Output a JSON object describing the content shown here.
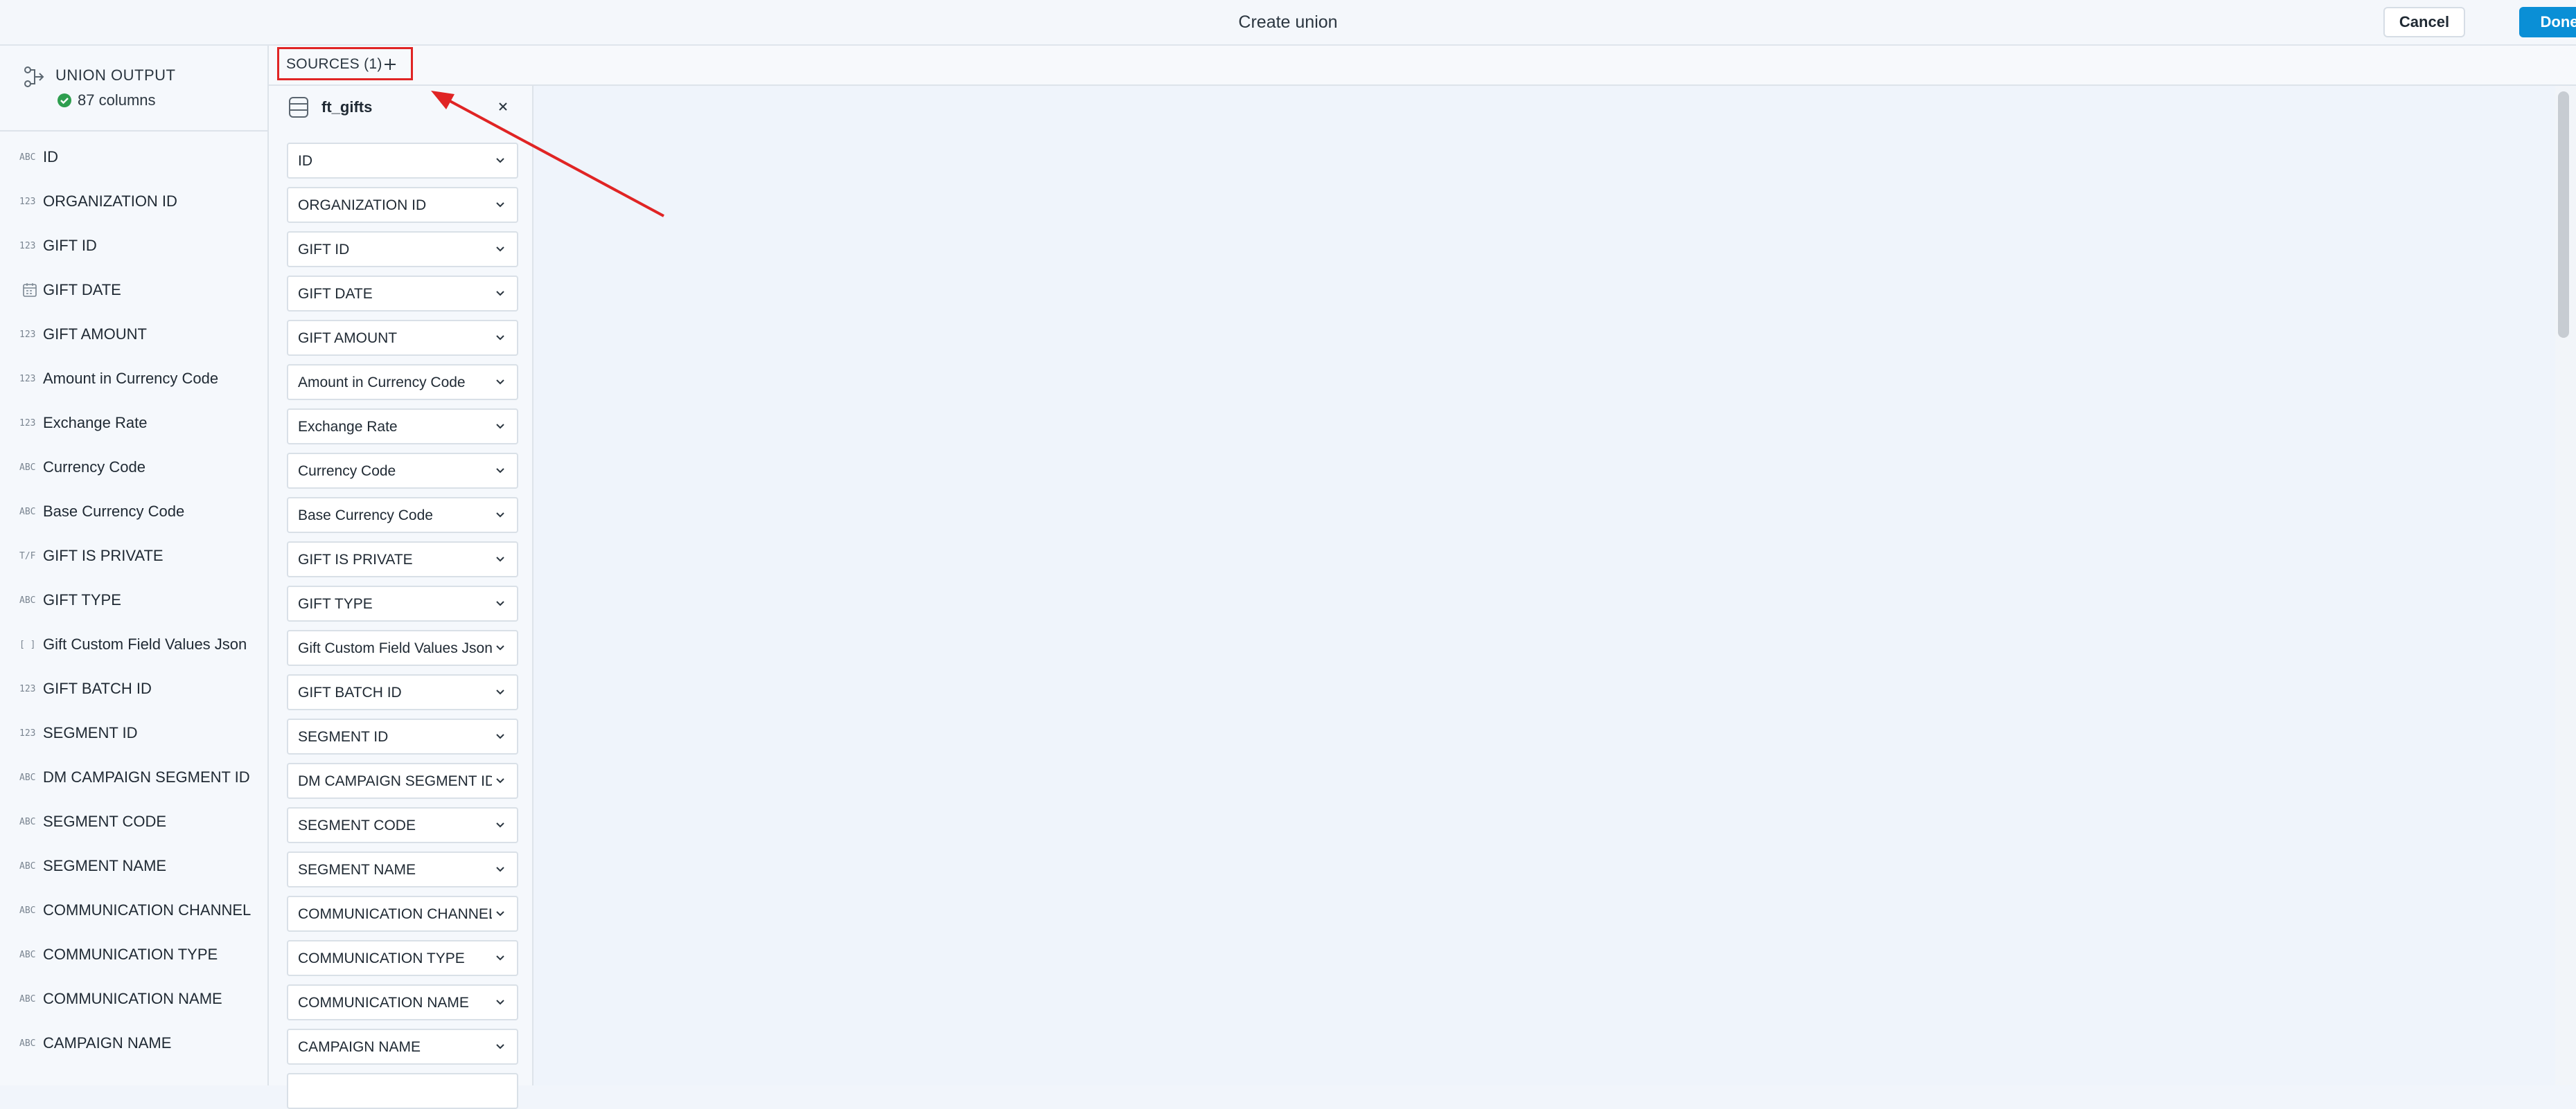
{
  "window": {
    "title": "Create union"
  },
  "actions": {
    "cancel_label": "Cancel",
    "done_label": "Done"
  },
  "output": {
    "title": "UNION OUTPUT",
    "column_count": "87 columns"
  },
  "sources": {
    "tab_label": "SOURCES (1)",
    "source_name": "ft_gifts"
  },
  "fields": [
    {
      "type": "ABC",
      "name": "ID",
      "selected": "ID"
    },
    {
      "type": "123",
      "name": "ORGANIZATION ID",
      "selected": "ORGANIZATION ID"
    },
    {
      "type": "123",
      "name": "GIFT ID",
      "selected": "GIFT ID"
    },
    {
      "type": "date",
      "name": "GIFT DATE",
      "selected": "GIFT DATE"
    },
    {
      "type": "123",
      "name": "GIFT AMOUNT",
      "selected": "GIFT AMOUNT"
    },
    {
      "type": "123",
      "name": "Amount in Currency Code",
      "selected": "Amount in Currency Code"
    },
    {
      "type": "123",
      "name": "Exchange Rate",
      "selected": "Exchange Rate"
    },
    {
      "type": "ABC",
      "name": "Currency Code",
      "selected": "Currency Code"
    },
    {
      "type": "ABC",
      "name": "Base Currency Code",
      "selected": "Base Currency Code"
    },
    {
      "type": "T/F",
      "name": "GIFT IS PRIVATE",
      "selected": "GIFT IS PRIVATE"
    },
    {
      "type": "ABC",
      "name": "GIFT TYPE",
      "selected": "GIFT TYPE"
    },
    {
      "type": "[ ]",
      "name": "Gift Custom Field Values Json",
      "selected": "Gift Custom Field Values Json"
    },
    {
      "type": "123",
      "name": "GIFT BATCH ID",
      "selected": "GIFT BATCH ID"
    },
    {
      "type": "123",
      "name": "SEGMENT ID",
      "selected": "SEGMENT ID"
    },
    {
      "type": "ABC",
      "name": "DM CAMPAIGN SEGMENT ID",
      "selected": "DM CAMPAIGN SEGMENT ID"
    },
    {
      "type": "ABC",
      "name": "SEGMENT CODE",
      "selected": "SEGMENT CODE"
    },
    {
      "type": "ABC",
      "name": "SEGMENT NAME",
      "selected": "SEGMENT NAME"
    },
    {
      "type": "ABC",
      "name": "COMMUNICATION CHANNEL",
      "selected": "COMMUNICATION CHANNEL"
    },
    {
      "type": "ABC",
      "name": "COMMUNICATION TYPE",
      "selected": "COMMUNICATION TYPE"
    },
    {
      "type": "ABC",
      "name": "COMMUNICATION NAME",
      "selected": "COMMUNICATION NAME"
    },
    {
      "type": "ABC",
      "name": "CAMPAIGN NAME",
      "selected": "CAMPAIGN NAME"
    }
  ],
  "colors": {
    "accent": "#0a8fd6",
    "highlight": "#e02424",
    "success": "#2e9e4f"
  },
  "icons": {
    "union": "union-output-icon",
    "check": "check-circle-icon",
    "add": "plus-icon",
    "source": "database-icon",
    "close": "close-icon",
    "dropdown": "chevron-down-icon"
  }
}
